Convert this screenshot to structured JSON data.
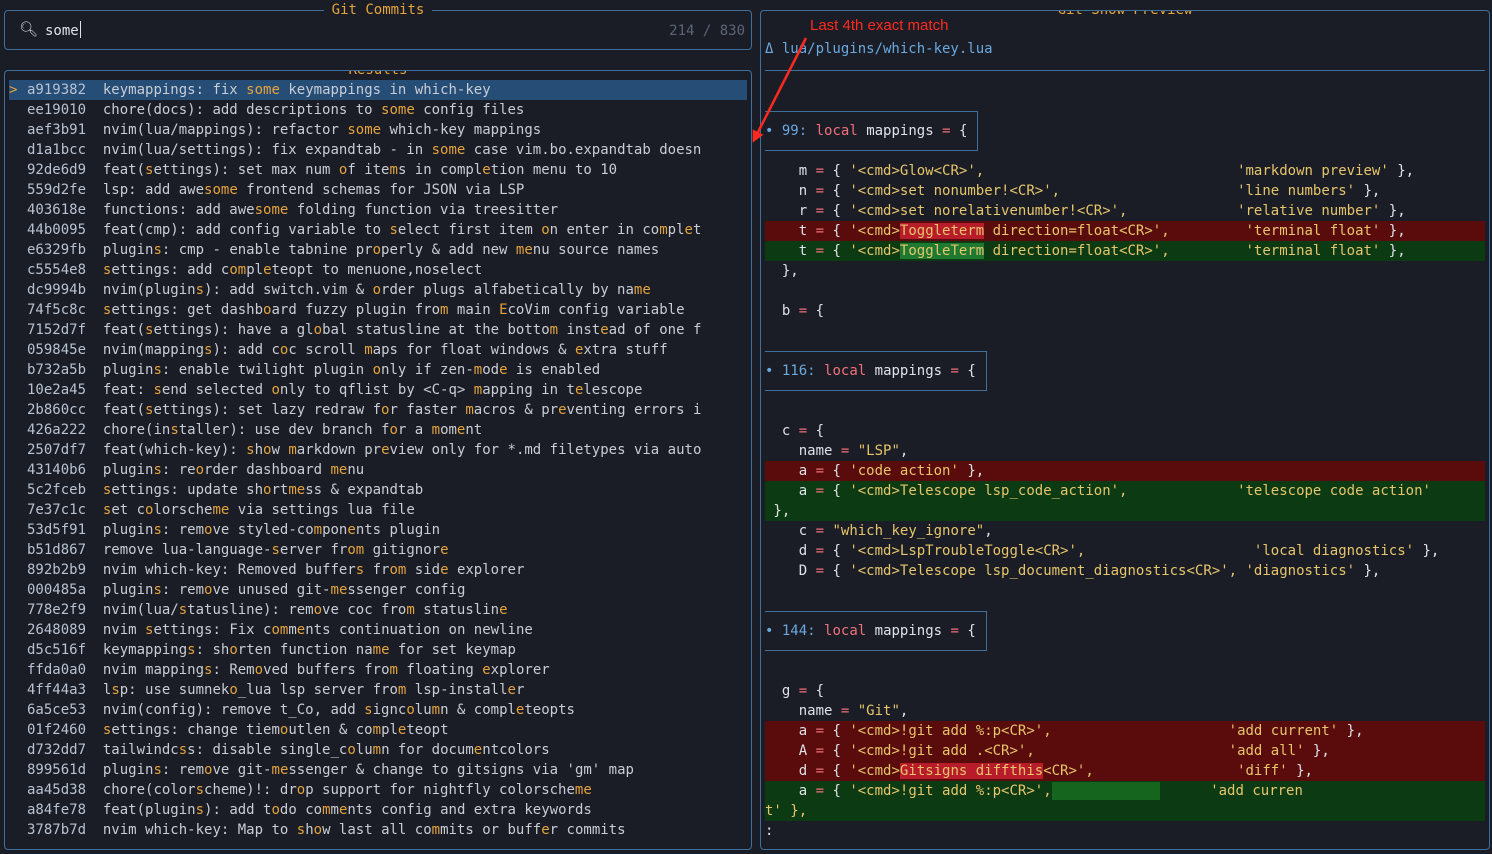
{
  "prompt": {
    "title": "Git Commits",
    "query": "some",
    "counter": "214 / 830"
  },
  "results": {
    "title": "Results",
    "selected_caret": ">",
    "rows": [
      {
        "hash": "a919382",
        "msg": "keymappings: fix some keymappings in which-key",
        "selected": true
      },
      {
        "hash": "ee19010",
        "msg": "chore(docs): add descriptions to some config files"
      },
      {
        "hash": "aef3b91",
        "msg": "nvim(lua/mappings): refactor some which-key mappings"
      },
      {
        "hash": "d1a1bcc",
        "msg": "nvim(lua/settings): fix expandtab - in some case vim.bo.expandtab doesn"
      },
      {
        "hash": "92de6d9",
        "msg": "feat(settings): set max num of items in completion menu to 10"
      },
      {
        "hash": "559d2fe",
        "msg": "lsp: add awesome frontend schemas for JSON via LSP"
      },
      {
        "hash": "403618e",
        "msg": "functions: add awesome folding function via treesitter"
      },
      {
        "hash": "44b0095",
        "msg": "feat(cmp): add config variable to select first item on enter in complet"
      },
      {
        "hash": "e6329fb",
        "msg": "plugins: cmp - enable tabnine properly & add new menu source names"
      },
      {
        "hash": "c5554e8",
        "msg": "settings: add completeopt to menuone,noselect"
      },
      {
        "hash": "dc9994b",
        "msg": "nvim(plugins): add switch.vim & order plugs alfabetically by name"
      },
      {
        "hash": "74f5c8c",
        "msg": "settings: get dashboard fuzzy plugin from main EcoVim config variable"
      },
      {
        "hash": "7152d7f",
        "msg": "feat(settings): have a global statusline at the bottom instead of one f"
      },
      {
        "hash": "059845e",
        "msg": "nvim(mappings): add coc scroll maps for float windows & extra stuff"
      },
      {
        "hash": "b732a5b",
        "msg": "plugins: enable twilight plugin only if zen-mode is enabled"
      },
      {
        "hash": "10e2a45",
        "msg": "feat: send selected only to qflist by <C-q> mapping in telescope"
      },
      {
        "hash": "2b860cc",
        "msg": "feat(settings): set lazy redraw for faster macros & preventing errors i"
      },
      {
        "hash": "426a222",
        "msg": "chore(installer): use dev branch for a moment"
      },
      {
        "hash": "2507df7",
        "msg": "feat(which-key): show markdown preview only for *.md filetypes via auto"
      },
      {
        "hash": "43140b6",
        "msg": "plugins: reorder dashboard menu"
      },
      {
        "hash": "5c2fceb",
        "msg": "settings: update shortmess & expandtab"
      },
      {
        "hash": "7e37c1c",
        "msg": "set colorscheme via settings lua file"
      },
      {
        "hash": "53d5f91",
        "msg": "plugins: remove styled-components plugin"
      },
      {
        "hash": "b51d867",
        "msg": "remove lua-language-server from gitignore"
      },
      {
        "hash": "892b2b9",
        "msg": "nvim which-key: Removed buffers from side explorer"
      },
      {
        "hash": "000485a",
        "msg": "plugins: remove unused git-messenger config"
      },
      {
        "hash": "778e2f9",
        "msg": "nvim(lua/statusline): remove coc from statusline"
      },
      {
        "hash": "2648089",
        "msg": "nvim settings: Fix comments continuation on newline"
      },
      {
        "hash": "d5c516f",
        "msg": "keymappings: shorten function name for set keymap"
      },
      {
        "hash": "ffda0a0",
        "msg": "nvim mappings: Removed buffers from floating explorer"
      },
      {
        "hash": "4ff44a3",
        "msg": "lsp: use sumneko_lua lsp server from lsp-installer"
      },
      {
        "hash": "6a5ce53",
        "msg": "nvim(config): remove t_Co, add signcolumn & completeopts"
      },
      {
        "hash": "01f2460",
        "msg": "settings: change tiemoutlen & completeopt"
      },
      {
        "hash": "d732dd7",
        "msg": "tailwindcss: disable single_column for documentcolors"
      },
      {
        "hash": "899561d",
        "msg": "plugins: remove git-messenger & change to gitsigns via 'gm' map"
      },
      {
        "hash": "aa45d38",
        "msg": "chore(colorscheme)!: drop support for nightfly colorscheme"
      },
      {
        "hash": "a84fe78",
        "msg": "feat(plugins): add todo comments config and extra keywords"
      },
      {
        "hash": "3787b7d",
        "msg": "nvim which-key: Map to show last all commits or buffer commits"
      }
    ]
  },
  "preview": {
    "title": "Git Show Preview",
    "file": "Δ lua/plugins/which-key.lua",
    "hunks": [
      {
        "bullet": "•",
        "line": "99",
        "kw": "local",
        "ident": "mappings",
        "op": "=",
        "brace": "{"
      },
      {
        "bullet": "•",
        "line": "116",
        "kw": "local",
        "ident": "mappings",
        "op": "=",
        "brace": "{"
      },
      {
        "bullet": "•",
        "line": "144",
        "kw": "local",
        "ident": "mappings",
        "op": "=",
        "brace": "{"
      }
    ],
    "block1": {
      "m": {
        "k": "    m",
        "cmd": "'<cmd>Glow<CR>',",
        "desc": "'markdown preview'",
        "tail": " },"
      },
      "n": {
        "k": "    n",
        "cmd": "'<cmd>set nonumber!<CR>',",
        "desc": "'line numbers'",
        "tail": " },"
      },
      "r": {
        "k": "    r",
        "cmd": "'<cmd>set norelativenumber!<CR>',",
        "desc": "'relative number'",
        "tail": " },"
      },
      "t_del": {
        "k": "    t",
        "pre": "'<cmd>",
        "hl": "Toggleterm",
        "post": " direction=float<CR>',",
        "desc": "'terminal float'",
        "tail": " },"
      },
      "t_add": {
        "k": "    t",
        "pre": "'<cmd>",
        "hl": "ToggleTerm",
        "post": " direction=float<CR>',",
        "desc": "'terminal float'",
        "tail": " },"
      },
      "close": "  },",
      "b": "  b"
    },
    "block2": {
      "c": "  c",
      "name_key": "    name",
      "name_val": "\"LSP\"",
      "a_del": {
        "k": "    a",
        "cmd": "'code action'",
        "tail": " },"
      },
      "a_add": {
        "k": "    a",
        "cmd": "'<cmd>Telescope lsp_code_action',",
        "desc": "'telescope code action'"
      },
      "wrap": " },",
      "c2_key": "    c",
      "c2_val": "\"which_key_ignore\"",
      "d": {
        "k": "    d",
        "cmd": "'<cmd>LspTroubleToggle<CR>',",
        "desc": "'local diagnostics'",
        "tail": " },"
      },
      "D": {
        "k": "    D",
        "cmd": "'<cmd>Telescope lsp_document_diagnostics<CR>',",
        "desc": "'diagnostics'",
        "tail": " },"
      }
    },
    "block3": {
      "g": "  g",
      "name_key": "    name",
      "name_val": "\"Git\"",
      "a_del": {
        "k": "    a",
        "cmd": "'<cmd>!git add %:p<CR>',",
        "desc": "'add current'",
        "tail": " },"
      },
      "A_del": {
        "k": "    A",
        "cmd": "'<cmd>!git add .<CR>',",
        "desc": "'add all'",
        "tail": " },"
      },
      "d_del": {
        "k": "    d",
        "pre": "'<cmd>",
        "hl": "Gitsigns diffthis",
        "post": "<CR>',",
        "desc": "'diff'",
        "tail": " },"
      },
      "a_add": {
        "k": "    a",
        "cmd": "'<cmd>!git add %:p<CR>',",
        "desc": "'add curren"
      },
      "wrap": "t' },",
      "cmdline": ":"
    }
  },
  "annotation": {
    "text": "Last 4th exact match",
    "color": "#ff2a1f"
  }
}
